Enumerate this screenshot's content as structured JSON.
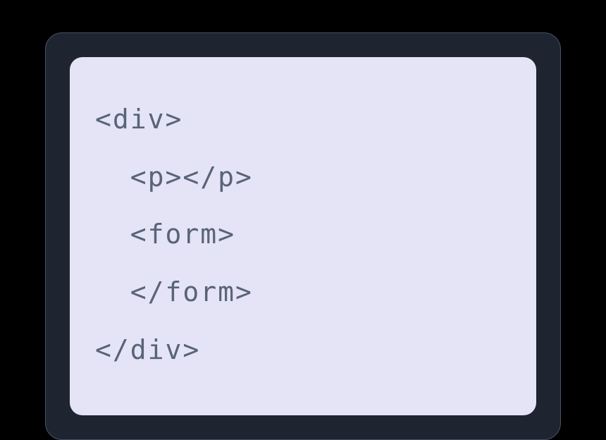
{
  "code": {
    "lines": [
      "<div>",
      "  <p></p>",
      "  <form>",
      "  </form>",
      "</div>"
    ]
  }
}
